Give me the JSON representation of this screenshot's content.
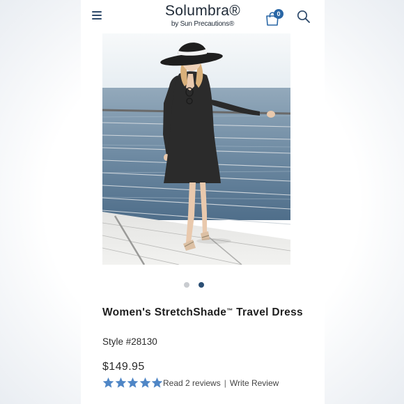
{
  "header": {
    "brand": "Solumbra®",
    "brand_sub": "by Sun Precautions®",
    "cart_count": "0",
    "icons": [
      "hamburger-menu-icon",
      "shopping-bag-icon",
      "search-icon"
    ]
  },
  "gallery": {
    "image_subject": "woman-black-dress-wide-brim-hat-on-deck",
    "slide_count": 2,
    "active_slide": 2
  },
  "product": {
    "title_main": "Women's StretchShade",
    "title_tm": "™",
    "title_end": " Travel Dress",
    "style": "Style #28130",
    "price": "$149.95",
    "rating": 5,
    "reviews_link": "Read 2 reviews",
    "separator": "|",
    "write_review": "Write Review"
  },
  "colors": {
    "accent": "#2a67a6",
    "star": "#4f86c6",
    "dot_active": "#2b4f74",
    "dot_inactive": "#c9ccd0"
  }
}
